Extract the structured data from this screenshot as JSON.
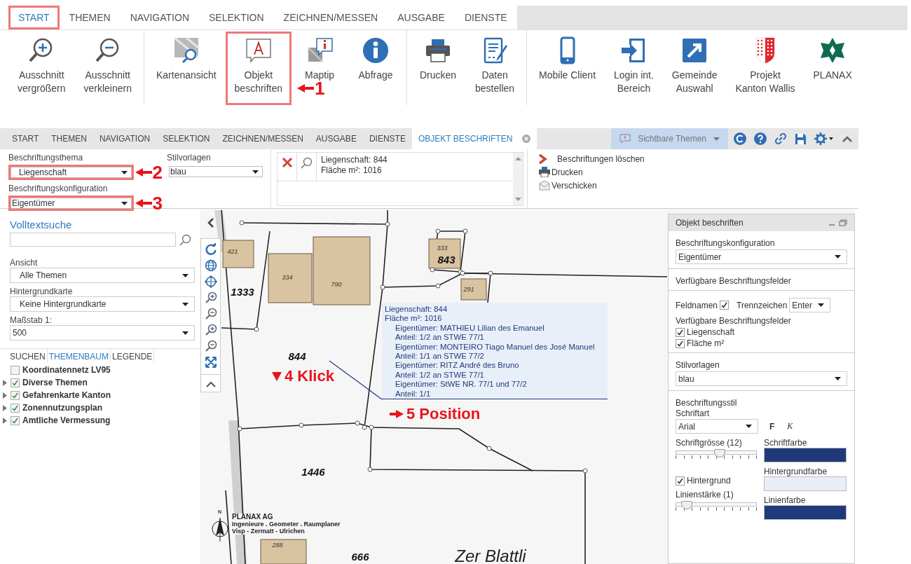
{
  "ribbon": {
    "tabs": [
      {
        "label": "START",
        "selected": true,
        "highlighted": true
      },
      {
        "label": "THEMEN",
        "selected": false,
        "highlighted": false
      },
      {
        "label": "NAVIGATION",
        "selected": false,
        "highlighted": false
      },
      {
        "label": "SELEKTION",
        "selected": false,
        "highlighted": false
      },
      {
        "label": "ZEICHNEN/MESSEN",
        "selected": false,
        "highlighted": false
      },
      {
        "label": "AUSGABE",
        "selected": false,
        "highlighted": false
      },
      {
        "label": "DIENSTE",
        "selected": false,
        "highlighted": false
      }
    ],
    "groups": [
      [
        {
          "lines": [
            "Ausschnitt",
            "vergrößern"
          ],
          "highlighted": false
        },
        {
          "lines": [
            "Ausschnitt",
            "verkleinern"
          ],
          "highlighted": false
        }
      ],
      [
        {
          "lines": [
            "Kartenansicht"
          ],
          "highlighted": false
        },
        {
          "lines": [
            "Objekt",
            "beschriften"
          ],
          "highlighted": true,
          "marker": "1"
        },
        {
          "lines": [
            "Maptip"
          ],
          "highlighted": false
        },
        {
          "lines": [
            "Abfrage"
          ],
          "highlighted": false
        }
      ],
      [
        {
          "lines": [
            "Drucken"
          ],
          "highlighted": false
        },
        {
          "lines": [
            "Daten",
            "bestellen"
          ],
          "highlighted": false
        }
      ],
      [
        {
          "lines": [
            "Mobile Client"
          ],
          "highlighted": false
        },
        {
          "lines": [
            "Login int.",
            "Bereich"
          ],
          "highlighted": false
        },
        {
          "lines": [
            "Gemeinde",
            "Auswahl"
          ],
          "highlighted": false
        },
        {
          "lines": [
            "Projekt",
            "Kanton Wallis"
          ],
          "highlighted": false
        },
        {
          "lines": [
            "PLANAX"
          ],
          "highlighted": false
        }
      ]
    ]
  },
  "app": {
    "tabs": [
      {
        "label": "START",
        "selected": false,
        "closable": false
      },
      {
        "label": "THEMEN",
        "selected": false,
        "closable": false
      },
      {
        "label": "NAVIGATION",
        "selected": false,
        "closable": false
      },
      {
        "label": "SELEKTION",
        "selected": false,
        "closable": false
      },
      {
        "label": "ZEICHNEN/MESSEN",
        "selected": false,
        "closable": false
      },
      {
        "label": "AUSGABE",
        "selected": false,
        "closable": false
      },
      {
        "label": "DIENSTE",
        "selected": false,
        "closable": false
      },
      {
        "label": "OBJEKT BESCHRIFTEN",
        "selected": true,
        "closable": true
      }
    ],
    "theme_menu": "Sichtbare Themen",
    "toolbar": {
      "theme_field": {
        "label": "Beschriftungsthema",
        "value": "Liegenschaft",
        "highlighted": true,
        "marker": "2"
      },
      "config_field": {
        "label": "Beschriftungskonfiguration",
        "value": "Eigentümer",
        "highlighted": true,
        "marker": "3"
      },
      "style_field": {
        "label": "Stilvorlagen",
        "value": "blau"
      },
      "labels": [
        "Liegenschaft: 844",
        "Fläche m²: 1016"
      ],
      "actions": [
        "Beschriftungen löschen",
        "Drucken",
        "Verschicken"
      ]
    }
  },
  "left_panel": {
    "search_title": "Volltextsuche",
    "selects": [
      {
        "label": "Ansicht",
        "value": "Alle Themen"
      },
      {
        "label": "Hintergrundkarte",
        "value": "Keine Hintergrundkarte"
      },
      {
        "label": "Maßstab 1:",
        "value": "500"
      }
    ],
    "tabs": [
      {
        "label": "SUCHEN",
        "selected": false
      },
      {
        "label": "THEMENBAUM",
        "selected": true
      },
      {
        "label": "LEGENDE",
        "selected": false
      }
    ],
    "tree": [
      {
        "kind": "layer",
        "label": "Koordinatennetz LV95",
        "checked": false
      },
      {
        "kind": "group",
        "label": "Diverse Themen",
        "checked": true,
        "expanded": false
      },
      {
        "kind": "group",
        "label": "Gefahrenkarte Kanton",
        "checked": true,
        "expanded": false
      },
      {
        "kind": "group",
        "label": "Zonennutzungsplan",
        "checked": true,
        "expanded": false
      },
      {
        "kind": "group",
        "label": "Amtliche Vermessung",
        "checked": true,
        "expanded": false
      }
    ]
  },
  "map": {
    "labels": [
      {
        "text": "421",
        "kind": "building"
      },
      {
        "text": "334",
        "kind": "building"
      },
      {
        "text": "790",
        "kind": "building"
      },
      {
        "text": "333",
        "kind": "building"
      },
      {
        "text": "843",
        "kind": "parcel"
      },
      {
        "text": "291",
        "kind": "building"
      },
      {
        "text": "1333",
        "kind": "parcel"
      },
      {
        "text": "844",
        "kind": "parcel"
      },
      {
        "text": "1446",
        "kind": "parcel"
      },
      {
        "text": "666",
        "kind": "parcel"
      },
      {
        "text": "288",
        "kind": "building"
      }
    ],
    "place_name": "Zer Blattli",
    "callout": {
      "lines": [
        "Liegenschaft: 844",
        "Fläche m²: 1016"
      ],
      "owners": [
        {
          "owner": "Eigentümer: MATHIEU Lilian des Emanuel",
          "share": "Anteil: 1/2 an STWE 77/1"
        },
        {
          "owner": "Eigentümer: MONTEIRO Tiago Manuel des José Manuel",
          "share": "Anteil: 1/1 an STWE 77/2"
        },
        {
          "owner": "Eigentümer: RITZ André des Bruno",
          "share": "Anteil: 1/2 an STWE 77/1"
        },
        {
          "owner": "Eigentümer: StWE NR. 77/1 und 77/2",
          "share": "Anteil: 1/1"
        }
      ]
    },
    "north": "N",
    "imprint": [
      "PLANAX AG",
      "Ingenieure . Geometer . Raumplaner",
      "Visp - Zermatt - Ulrichen"
    ],
    "annotations": [
      {
        "kind": "down",
        "text": "4 Klick"
      },
      {
        "kind": "right",
        "text": "5 Position"
      }
    ]
  },
  "label_panel": {
    "title": "Objekt beschriften",
    "config": {
      "label": "Beschriftungskonfiguration",
      "value": "Eigentümer"
    },
    "fields_heading": "Verfügbare Beschriftungsfelder",
    "field_names": {
      "label": "Feldnamen",
      "checked": true
    },
    "separator": {
      "label": "Trennzeichen",
      "value": "Enter"
    },
    "fields_label": "Verfügbare Beschriftungsfelder",
    "fields": [
      {
        "label": "Liegenschaft",
        "checked": true
      },
      {
        "label": "Fläche m²",
        "checked": true
      }
    ],
    "style": {
      "label": "Stilvorlagen",
      "value": "blau"
    },
    "style_heading": "Beschriftungsstil",
    "font": {
      "label": "Schriftart",
      "value": "Arial"
    },
    "bold": "F",
    "italic": "K",
    "font_size": {
      "label": "Schriftgrösse (12)",
      "level": 0.55
    },
    "font_color": {
      "label": "Schriftfarbe",
      "color": "#1f3a7a"
    },
    "background": {
      "label": "Hintergrund",
      "checked": true
    },
    "background_color": {
      "label": "Hintergrundfarbe",
      "color": "#e8eef8"
    },
    "line_width": {
      "label": "Linienstärke (1)",
      "level": 0.15
    },
    "line_color": {
      "label": "Linienfarbe",
      "color": "#1f3a7a"
    }
  }
}
